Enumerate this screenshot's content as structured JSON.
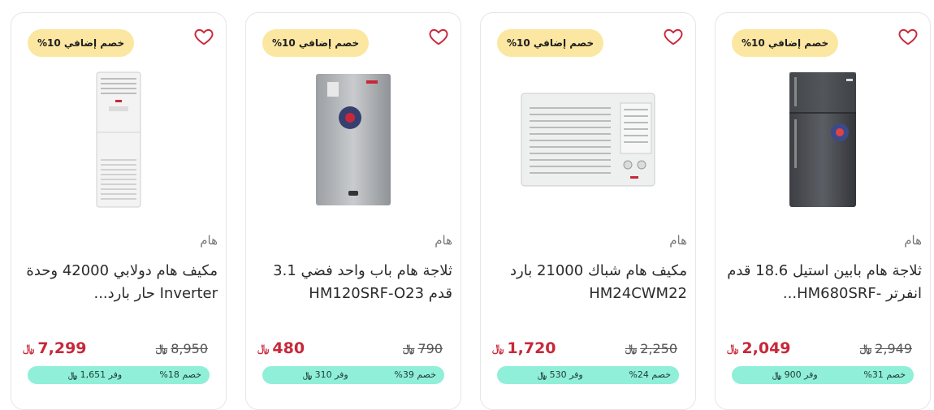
{
  "products": [
    {
      "promo": "خصم إضافي 10%",
      "image": "fridge-double-door-steel",
      "brand": "هام",
      "title": "ثلاجة هام بابين استيل 18.6 قدم انفرتر -HM680SRF...",
      "price": "2,049",
      "old_price": "2,949",
      "discount": "خصم 31%",
      "save_label": "وفر",
      "save_amount": "900",
      "currency": "﷼"
    },
    {
      "promo": "خصم إضافي 10%",
      "image": "window-air-conditioner",
      "brand": "هام",
      "title": "مكيف هام شباك 21000 بارد HM24CWM22",
      "price": "1,720",
      "old_price": "2,250",
      "discount": "خصم 24%",
      "save_label": "وفر",
      "save_amount": "530",
      "currency": "﷼"
    },
    {
      "promo": "خصم إضافي 10%",
      "image": "fridge-single-door-silver",
      "brand": "هام",
      "title": "ثلاجة هام باب واحد فضي 3.1 قدم HM120SRF-O23",
      "price": "480",
      "old_price": "790",
      "discount": "خصم 39%",
      "save_label": "وفر",
      "save_amount": "310",
      "currency": "﷼"
    },
    {
      "promo": "خصم إضافي 10%",
      "image": "floor-standing-air-conditioner",
      "brand": "هام",
      "title": "مكيف هام دولابي 42000 وحدة Inverter حار بارد...",
      "price": "7,299",
      "old_price": "8,950",
      "discount": "خصم 18%",
      "save_label": "وفر",
      "save_amount": "1,651",
      "currency": "﷼"
    }
  ],
  "colors": {
    "price": "#c8283a",
    "promo_bg": "#fbe7a1",
    "savings_bg": "#8fefd8",
    "heart": "#c8283a"
  }
}
